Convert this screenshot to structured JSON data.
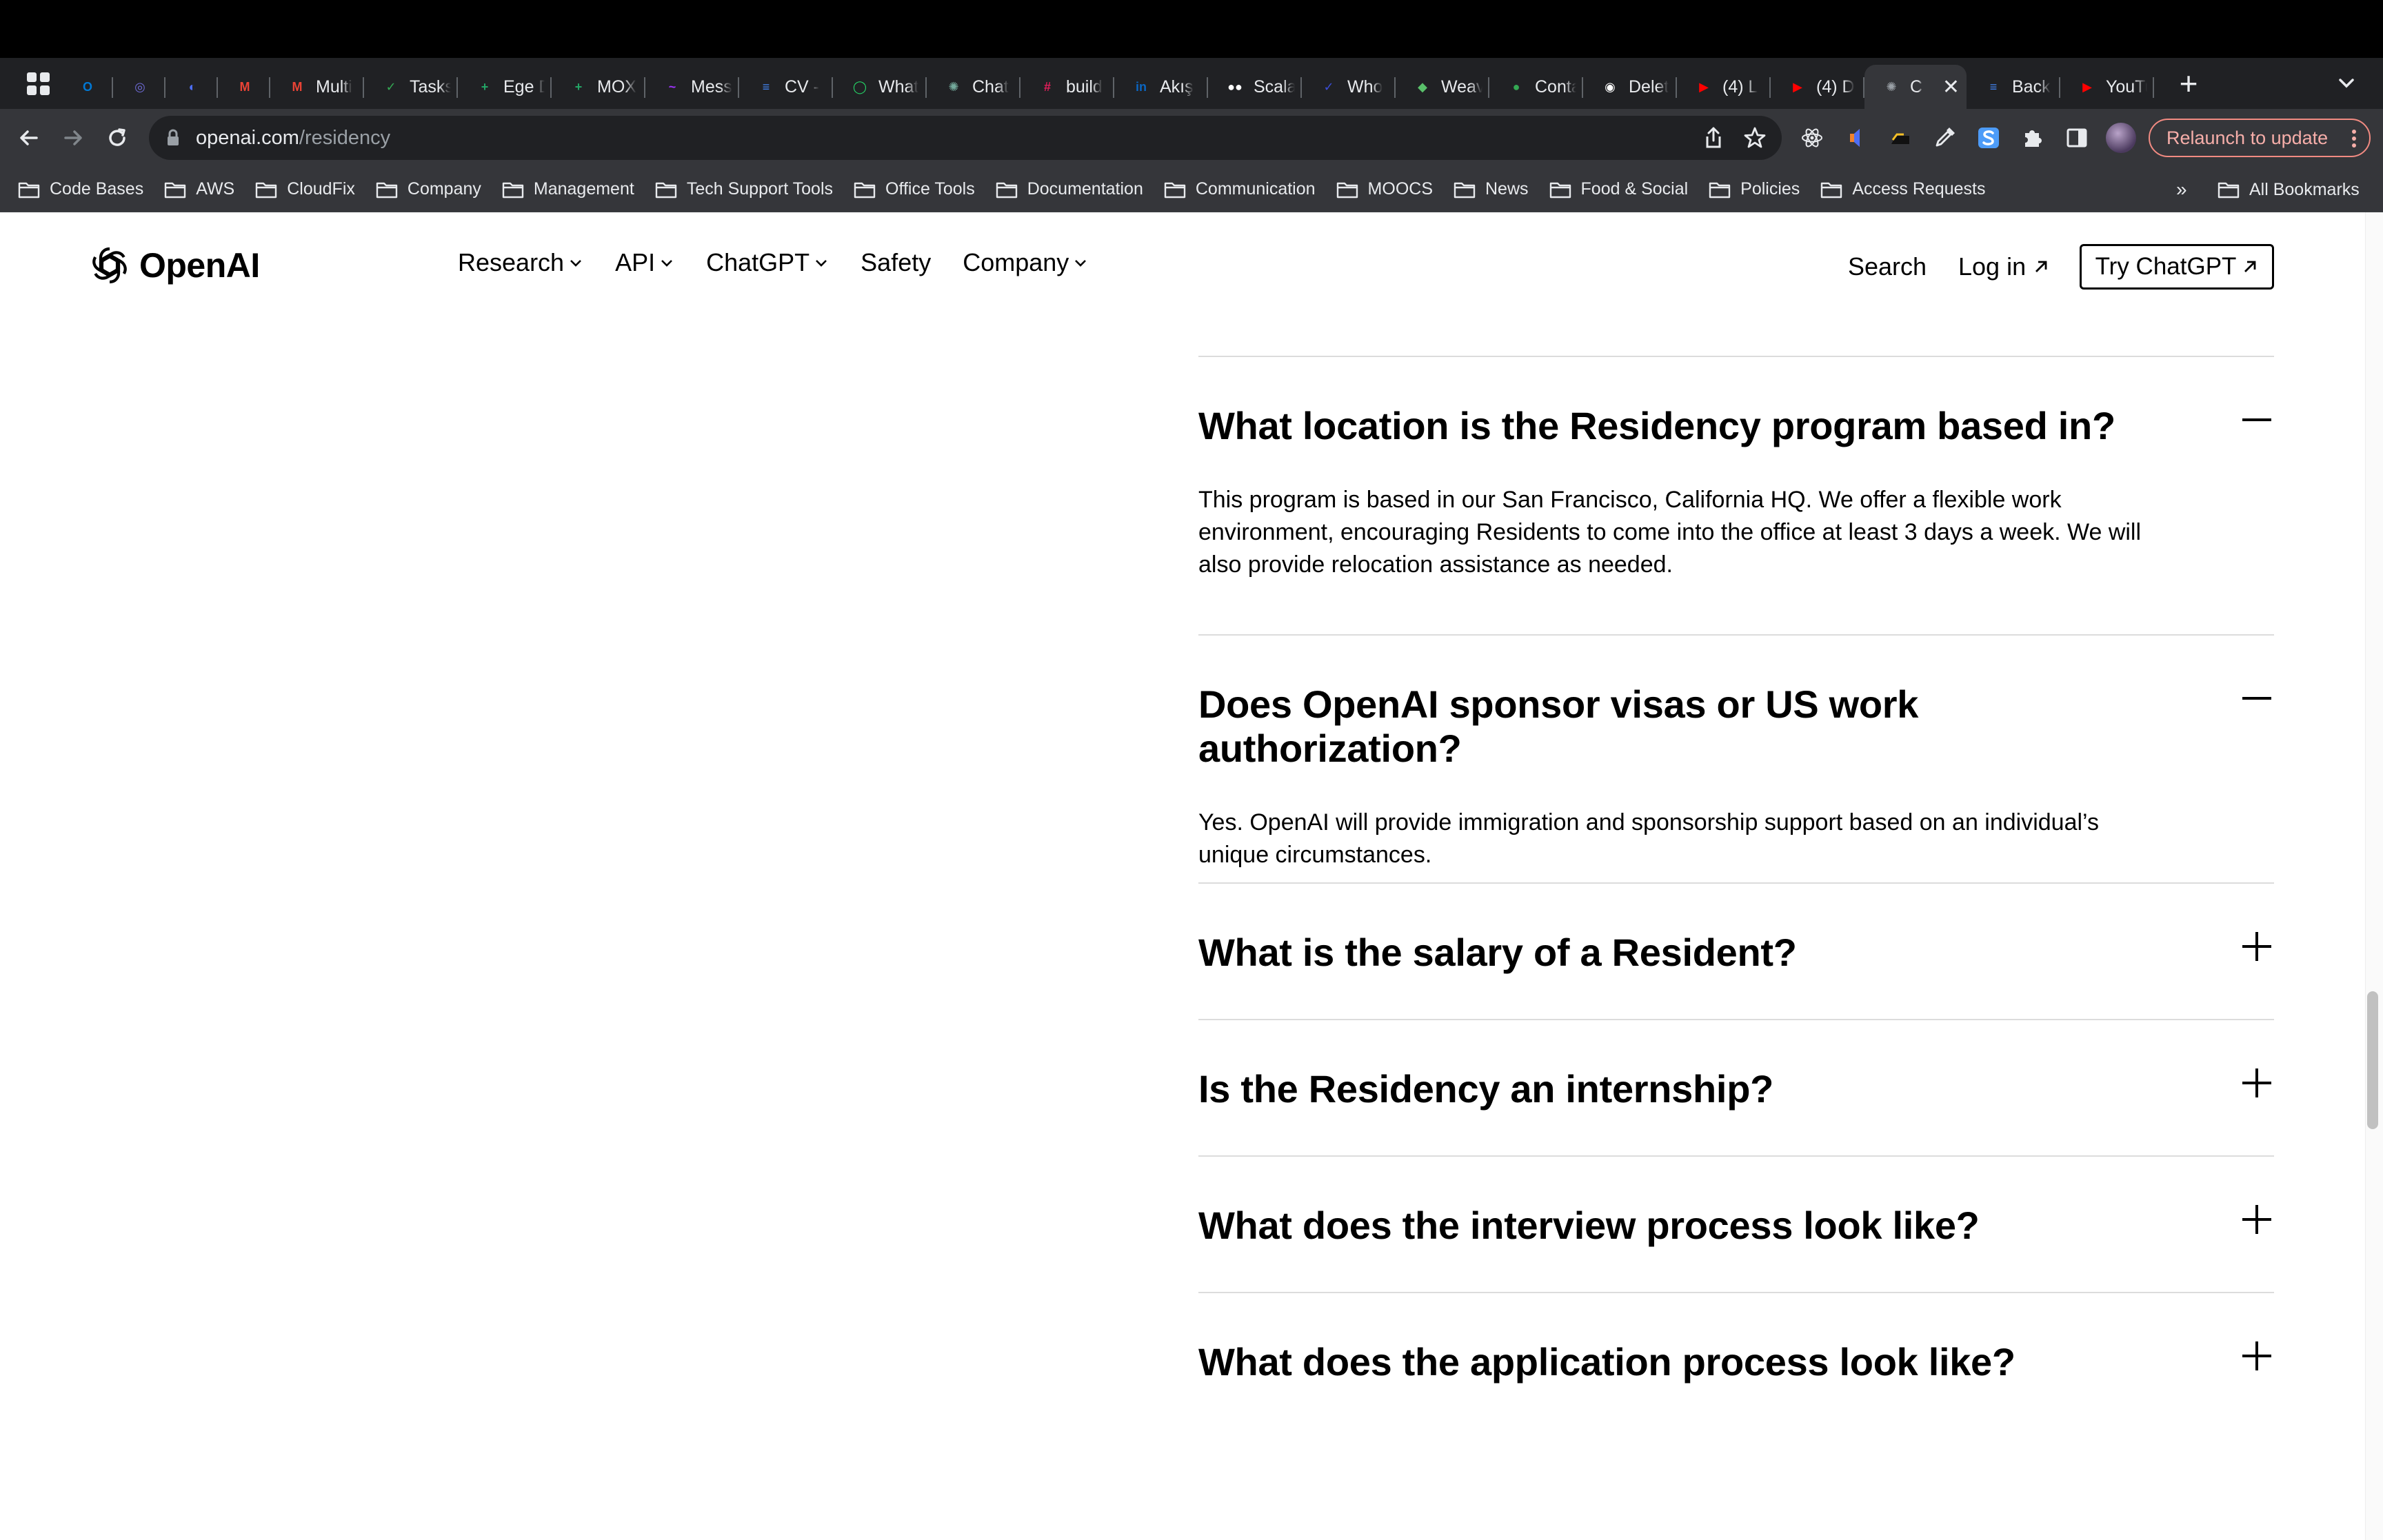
{
  "browser": {
    "tabs": [
      {
        "favicon": "apps-icon",
        "title": "",
        "color": "#e8eaed"
      },
      {
        "favicon": "outlook-icon",
        "title": "",
        "color": "#0078d4"
      },
      {
        "favicon": "copilot-icon",
        "title": "",
        "color": "#6e6bd6"
      },
      {
        "favicon": "timer-icon",
        "title": "",
        "color": "#4d6ef5"
      },
      {
        "favicon": "gmail-icon",
        "title": "",
        "color": "#ea4335"
      },
      {
        "favicon": "gmail-icon",
        "title": "Multi",
        "color": "#ea4335"
      },
      {
        "favicon": "tasks-icon",
        "title": "Tasks",
        "color": "#34a853"
      },
      {
        "favicon": "sheets-icon",
        "title": "Ege D",
        "color": "#23a566"
      },
      {
        "favicon": "sheets-icon",
        "title": "MOX",
        "color": "#23a566"
      },
      {
        "favicon": "messenger-icon",
        "title": "Mess",
        "color": "#a033ff"
      },
      {
        "favicon": "docs-icon",
        "title": "CV -",
        "color": "#4285f4"
      },
      {
        "favicon": "whatsapp-icon",
        "title": "What",
        "color": "#25d366"
      },
      {
        "favicon": "chatgpt-icon",
        "title": "Chat",
        "color": "#74aa9c"
      },
      {
        "favicon": "slack-icon",
        "title": "build",
        "color": "#e01e5a"
      },
      {
        "favicon": "linkedin-icon",
        "title": "Akış",
        "color": "#0a66c2"
      },
      {
        "favicon": "medium-icon",
        "title": "Scala",
        "color": "#ffffff"
      },
      {
        "favicon": "who-icon",
        "title": "Who",
        "color": "#3a4dd8"
      },
      {
        "favicon": "weaviate-icon",
        "title": "Weav",
        "color": "#59c06a"
      },
      {
        "favicon": "dot-icon",
        "title": "Conta",
        "color": "#34a853"
      },
      {
        "favicon": "github-icon",
        "title": "Delet",
        "color": "#ffffff"
      },
      {
        "favicon": "youtube-icon",
        "title": "(4) L",
        "color": "#ff0000"
      },
      {
        "favicon": "youtube-icon",
        "title": "(4) D",
        "color": "#ff0000"
      },
      {
        "favicon": "openai-icon",
        "title": "C",
        "color": "#9aa0a6",
        "active": true
      },
      {
        "favicon": "docs-icon",
        "title": "Back",
        "color": "#4285f4"
      },
      {
        "favicon": "youtube-icon",
        "title": "YouTu",
        "color": "#ff0000"
      }
    ],
    "new_tab_label": "+",
    "url_host": "openai.com",
    "url_path": "/residency",
    "relaunch_label": "Relaunch to update",
    "bookmarks": [
      "Code Bases",
      "AWS",
      "CloudFix",
      "Company",
      "Management",
      "Tech Support Tools",
      "Office Tools",
      "Documentation",
      "Communication",
      "MOOCS",
      "News",
      "Food & Social",
      "Policies",
      "Access Requests"
    ],
    "bookmarks_more": "»",
    "all_bookmarks": "All Bookmarks"
  },
  "site": {
    "logo_text": "OpenAI",
    "nav": [
      {
        "label": "Research",
        "dropdown": true
      },
      {
        "label": "API",
        "dropdown": true
      },
      {
        "label": "ChatGPT",
        "dropdown": true
      },
      {
        "label": "Safety",
        "dropdown": false
      },
      {
        "label": "Company",
        "dropdown": true
      }
    ],
    "search_label": "Search",
    "login_label": "Log in",
    "try_label": "Try ChatGPT"
  },
  "faq": [
    {
      "question": "What location is the Residency program based in?",
      "expanded": true,
      "answer": "This program is based in our San Francisco, California HQ. We offer a flexible work environment, encouraging Residents to come into the office at least 3 days a week. We will also provide relocation assistance as needed."
    },
    {
      "question": "Does OpenAI sponsor visas or US work authorization?",
      "expanded": true,
      "answer": "Yes. OpenAI will provide immigration and sponsorship support based on an individual’s unique circumstances."
    },
    {
      "question": "What is the salary of a Resident?",
      "expanded": false,
      "answer": ""
    },
    {
      "question": "Is the Residency an internship?",
      "expanded": false,
      "answer": ""
    },
    {
      "question": "What does the interview process look like?",
      "expanded": false,
      "answer": ""
    },
    {
      "question": "What does the application process look like?",
      "expanded": false,
      "answer": ""
    }
  ]
}
